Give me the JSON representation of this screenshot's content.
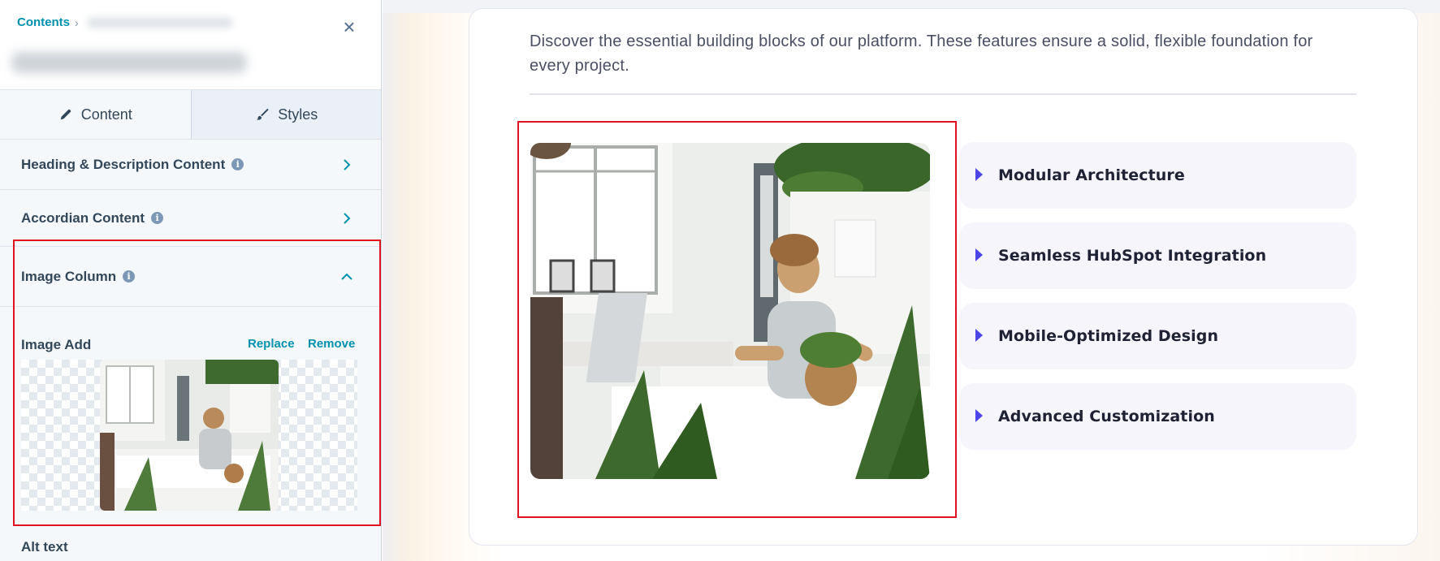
{
  "sidebar": {
    "breadcrumb_root": "Contents",
    "breadcrumb_separator": "›",
    "close_icon": "×",
    "tabs": [
      {
        "label": "Content",
        "icon": "pencil-icon",
        "active": true
      },
      {
        "label": "Styles",
        "icon": "brush-icon",
        "active": false
      }
    ],
    "sections": {
      "heading": "Heading & Description Content",
      "accordion": "Accordian Content",
      "image_column": "Image Column"
    },
    "info_glyph": "i",
    "image_add": {
      "label": "Image Add",
      "replace": "Replace",
      "remove": "Remove"
    },
    "alt_text_label": "Alt text"
  },
  "preview": {
    "description": "Discover the essential building blocks of our platform. These features ensure a solid, flexible foundation for every project.",
    "accordion_items": [
      "Modular Architecture",
      "Seamless HubSpot Integration",
      "Mobile-Optimized Design",
      "Advanced Customization"
    ]
  },
  "colors": {
    "highlight": "#e0141e",
    "link": "#0091ae",
    "accent": "#4b45e8"
  }
}
